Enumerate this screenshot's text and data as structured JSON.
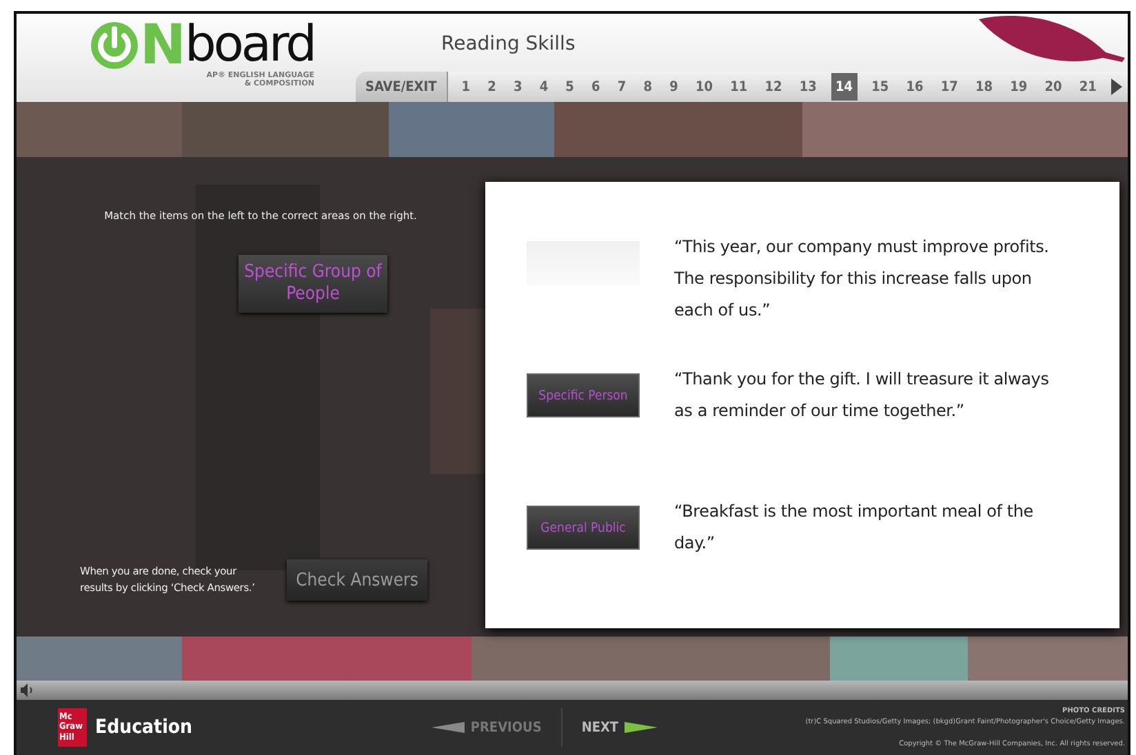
{
  "header": {
    "logo": {
      "letter": "N",
      "word": "board",
      "subtitle_lines": [
        "AP® ENGLISH LANGUAGE",
        "& COMPOSITION"
      ]
    },
    "title": "Reading Skills",
    "save_exit": "SAVE/EXIT",
    "pages": [
      {
        "label": "1",
        "selected": false
      },
      {
        "label": "2",
        "selected": false
      },
      {
        "label": "3",
        "selected": false
      },
      {
        "label": "4",
        "selected": false
      },
      {
        "label": "5",
        "selected": false
      },
      {
        "label": "6",
        "selected": false
      },
      {
        "label": "7",
        "selected": false
      },
      {
        "label": "8",
        "selected": false
      },
      {
        "label": "9",
        "selected": false
      },
      {
        "label": "10",
        "selected": false
      },
      {
        "label": "11",
        "selected": false
      },
      {
        "label": "12",
        "selected": false
      },
      {
        "label": "13",
        "selected": false
      },
      {
        "label": "14",
        "selected": true
      },
      {
        "label": "15",
        "selected": false
      },
      {
        "label": "16",
        "selected": false
      },
      {
        "label": "17",
        "selected": false
      },
      {
        "label": "18",
        "selected": false
      },
      {
        "label": "19",
        "selected": false
      },
      {
        "label": "20",
        "selected": false
      },
      {
        "label": "21",
        "selected": false
      }
    ]
  },
  "activity": {
    "instruction": "Match the items on the left to the correct areas on the right.",
    "draggable": "Specific Group of People",
    "done_hint": "When you are done, check your results by clicking ‘Check Answers.’",
    "check_button": "Check Answers",
    "pairs": [
      {
        "filled": false,
        "quote": "“This year, our company must improve profits. The responsibility for this increase falls upon each of us.”"
      },
      {
        "filled": true,
        "label": "Specific Person",
        "quote": "“Thank you for the gift. I will treasure it always as a reminder of our time together.”"
      },
      {
        "filled": true,
        "label": "General Public",
        "quote": "“Breakfast is the most important meal of the day.”"
      }
    ]
  },
  "footer": {
    "publisher_logo": [
      "Mc",
      "Graw",
      "Hill"
    ],
    "publisher": "Education",
    "previous": {
      "label": "PREVIOUS",
      "disabled": true
    },
    "next": {
      "label": "NEXT",
      "disabled": false
    },
    "photo_credits_title": "PHOTO CREDITS",
    "photo_credits": "(tr)C Squared Studios/Getty Images; (bkgd)Grant Faint/Photographer's Choice/Getty Images.",
    "copyright": "Copyright © The McGraw-Hill Companies, Inc. All rights reserved."
  }
}
